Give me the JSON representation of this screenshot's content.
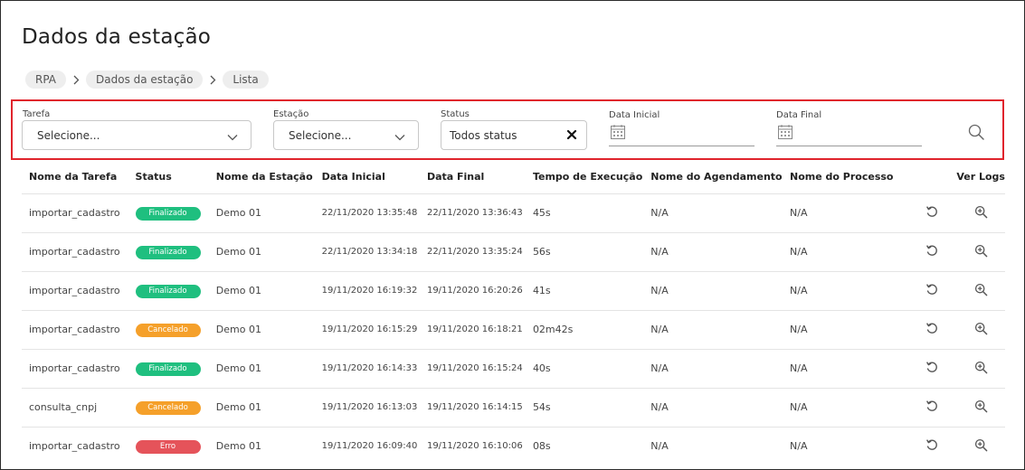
{
  "page": {
    "title": "Dados da estação"
  },
  "breadcrumb": [
    "RPA",
    "Dados da estação",
    "Lista"
  ],
  "filters": {
    "tarefa": {
      "label": "Tarefa",
      "value": "Selecione..."
    },
    "estacao": {
      "label": "Estação",
      "value": "Selecione..."
    },
    "status": {
      "label": "Status",
      "value": "Todos status"
    },
    "data_inicial": {
      "label": "Data Inicial",
      "value": ""
    },
    "data_final": {
      "label": "Data Final",
      "value": ""
    }
  },
  "table": {
    "headers": [
      "Nome da Tarefa",
      "Status",
      "Nome da Estação",
      "Data Inicial",
      "Data Final",
      "Tempo de Execução",
      "Nome do Agendamento",
      "Nome do Processo",
      "",
      "Ver Logs"
    ],
    "rows": [
      {
        "tarefa": "importar_cadastro",
        "status": "Finalizado",
        "estacao": "Demo 01",
        "inicio": "22/11/2020 13:35:48",
        "fim": "22/11/2020 13:36:43",
        "tempo": "45s",
        "agendamento": "N/A",
        "processo": "N/A"
      },
      {
        "tarefa": "importar_cadastro",
        "status": "Finalizado",
        "estacao": "Demo 01",
        "inicio": "22/11/2020 13:34:18",
        "fim": "22/11/2020 13:35:24",
        "tempo": "56s",
        "agendamento": "N/A",
        "processo": "N/A"
      },
      {
        "tarefa": "importar_cadastro",
        "status": "Finalizado",
        "estacao": "Demo 01",
        "inicio": "19/11/2020 16:19:32",
        "fim": "19/11/2020 16:20:26",
        "tempo": "41s",
        "agendamento": "N/A",
        "processo": "N/A"
      },
      {
        "tarefa": "importar_cadastro",
        "status": "Cancelado",
        "estacao": "Demo 01",
        "inicio": "19/11/2020 16:15:29",
        "fim": "19/11/2020 16:18:21",
        "tempo": "02m42s",
        "agendamento": "N/A",
        "processo": "N/A"
      },
      {
        "tarefa": "importar_cadastro",
        "status": "Finalizado",
        "estacao": "Demo 01",
        "inicio": "19/11/2020 16:14:33",
        "fim": "19/11/2020 16:15:24",
        "tempo": "40s",
        "agendamento": "N/A",
        "processo": "N/A"
      },
      {
        "tarefa": "consulta_cnpj",
        "status": "Cancelado",
        "estacao": "Demo 01",
        "inicio": "19/11/2020 16:13:03",
        "fim": "19/11/2020 16:14:15",
        "tempo": "54s",
        "agendamento": "N/A",
        "processo": "N/A"
      },
      {
        "tarefa": "importar_cadastro",
        "status": "Erro",
        "estacao": "Demo 01",
        "inicio": "19/11/2020 16:09:40",
        "fim": "19/11/2020 16:10:06",
        "tempo": "08s",
        "agendamento": "N/A",
        "processo": "N/A"
      }
    ]
  },
  "colors": {
    "Finalizado": "#1fbf7f",
    "Cancelado": "#f5a02a",
    "Erro": "#e5535a",
    "highlight_border": "#e0242c"
  },
  "icons": {
    "search": "search-icon",
    "calendar": "calendar-icon",
    "retry": "retry-icon",
    "view_logs": "zoom-in-icon",
    "clear": "close-icon",
    "dropdown": "chevron-down-icon",
    "breadcrumb_separator": "chevron-right-icon"
  }
}
